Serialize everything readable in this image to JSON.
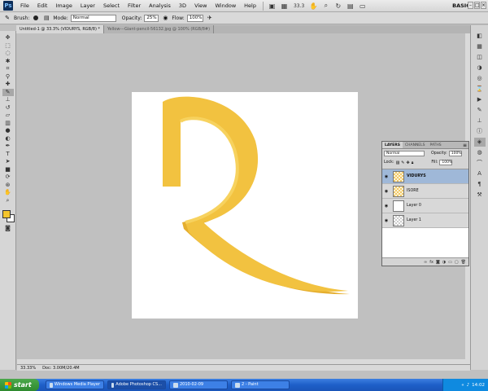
{
  "menubar": {
    "logo": "Ps",
    "items": [
      "File",
      "Edit",
      "Image",
      "Layer",
      "Select",
      "Filter",
      "Analysis",
      "3D",
      "View",
      "Window",
      "Help"
    ],
    "zoom": "33.3",
    "workspace": "BASIC",
    "window_controls": [
      "–",
      "□",
      "×"
    ]
  },
  "options": {
    "brush_label": "Brush:",
    "mode_label": "Mode:",
    "mode_value": "Normal",
    "opacity_label": "Opacity:",
    "opacity_value": "25%",
    "flow_label": "Flow:",
    "flow_value": "100%"
  },
  "tabs": [
    {
      "label": "Untitled-1 @ 33.3% (VIDURYS, RGB/8) *",
      "active": true
    },
    {
      "label": "Yellow---Giant-pencil-56132.jpg @ 100% (RGB/8#)",
      "active": false
    }
  ],
  "status": {
    "zoom": "33.33%",
    "doc": "Doc: 3.00M/20.4M"
  },
  "layers_panel": {
    "tabs": [
      "LAYERS",
      "CHANNELS",
      "PATHS"
    ],
    "blend_mode": "Normal",
    "opacity_label": "Opacity:",
    "opacity_value": "100%",
    "lock_label": "Lock:",
    "fill_label": "Fill:",
    "fill_value": "100%",
    "layers": [
      {
        "name": "VIDURYS",
        "thumb": "yellow",
        "selected": true
      },
      {
        "name": "ISORE",
        "thumb": "yellow",
        "selected": false
      },
      {
        "name": "Layer 0",
        "thumb": "white",
        "selected": false
      },
      {
        "name": "Layer 1",
        "thumb": "checker",
        "selected": false
      }
    ]
  },
  "taskbar": {
    "start": "start",
    "tasks": [
      {
        "label": "Windows Media Player",
        "active": false
      },
      {
        "label": "Adobe Photoshop CS...",
        "active": true
      },
      {
        "label": "2010-02-09",
        "active": false
      },
      {
        "label": "2 - Paint",
        "active": false
      }
    ],
    "clock": "14:02"
  },
  "colors": {
    "foreground": "#f5c52c",
    "background": "#ffffff",
    "shape_main": "#f2c240",
    "shape_light": "#f7d25e",
    "shape_dark": "#e5ae2e"
  }
}
